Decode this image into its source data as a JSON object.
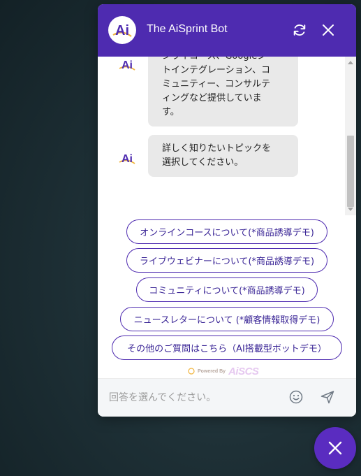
{
  "header": {
    "avatar_text": "Ai",
    "title": "The AiSprint Bot",
    "refresh_icon": "refresh-icon",
    "close_icon": "close-icon"
  },
  "messages": [
    {
      "avatar_text": "Ai",
      "text": "ンライコース、Googleシ\nトインテグレーション、コ\nミュニティー、コンサルテ\nィングなど提供していま\nす。"
    },
    {
      "avatar_text": "Ai",
      "text": "詳しく知りたいトピックを\n選択してください。"
    }
  ],
  "quick_replies": [
    "オンラインコースについて(*商品誘導デモ)",
    "ライブウェビナーについて(*商品誘導デモ)",
    "コミュニティについて(*商品誘導デモ)",
    "ニュースレターについて (*顧客情報取得デモ)",
    "その他のご質問はこちら（AI搭載型ボットデモ）"
  ],
  "powered": {
    "label": "Powered By",
    "brand": "AiSCS"
  },
  "input": {
    "placeholder": "回答を選んでください。",
    "emoji_icon": "smile-icon",
    "send_icon": "send-icon"
  },
  "fab": {
    "icon": "close-icon"
  },
  "colors": {
    "brand_purple": "#4e2bb0",
    "bubble_bg": "#e9e9e9",
    "logo_gold": "#f0b43c"
  }
}
